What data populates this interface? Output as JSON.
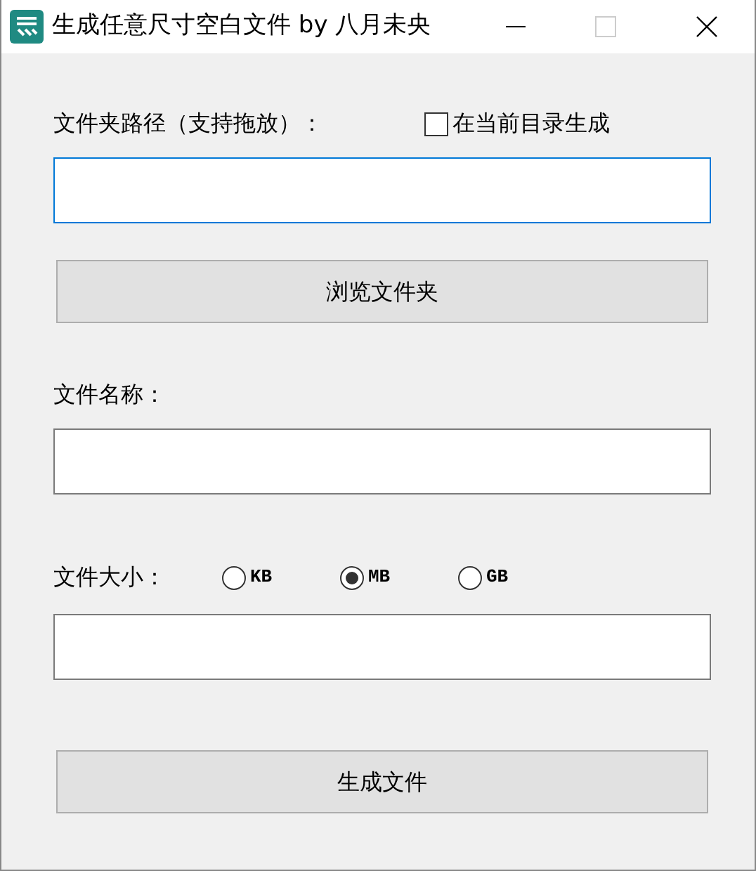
{
  "window": {
    "title": "生成任意尺寸空白文件 by 八月未央"
  },
  "folder": {
    "label": "文件夹路径（支持拖放）：",
    "checkbox": {
      "label": "在当前目录生成",
      "checked": false
    },
    "field": {
      "focused": true
    },
    "button": "浏览文件夹"
  },
  "name": {
    "label": "文件名称：",
    "field": {
      "focused": false
    }
  },
  "size": {
    "label": "文件大小：",
    "units": [
      {
        "label": "KB",
        "selected": false
      },
      {
        "label": "MB",
        "selected": true
      },
      {
        "label": "GB",
        "selected": false
      }
    ],
    "field": {
      "focused": false
    }
  },
  "generate_button": "生成文件"
}
